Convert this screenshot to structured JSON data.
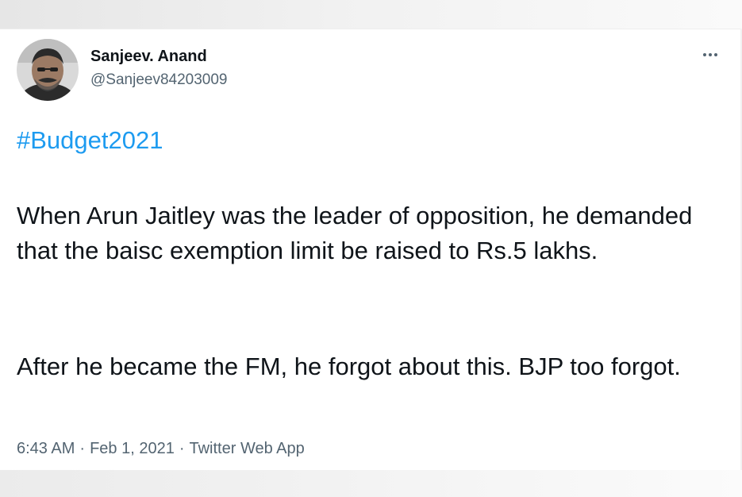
{
  "user": {
    "display_name": "Sanjeev. Anand",
    "handle": "@Sanjeev84203009"
  },
  "tweet": {
    "hashtag": "#Budget2021",
    "paragraph1": "When Arun Jaitley was the leader of opposition, he demanded that the baisc exemption limit be raised to Rs.5 lakhs.",
    "paragraph2": "After he became the FM, he forgot about this. BJP too forgot."
  },
  "meta": {
    "time": "6:43 AM",
    "separator": "·",
    "date": "Feb 1, 2021",
    "source": "Twitter Web App"
  },
  "icons": {
    "more": "more-options-icon"
  },
  "colors": {
    "text": "#0f1419",
    "secondary": "#536471",
    "link": "#1d9bf0"
  }
}
